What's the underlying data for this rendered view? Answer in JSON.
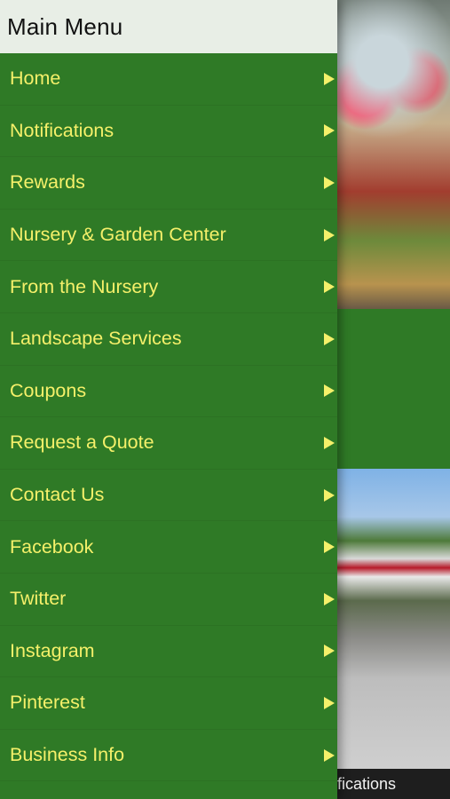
{
  "header": {
    "title": "Main Menu"
  },
  "menu": {
    "items": [
      {
        "label": "Home"
      },
      {
        "label": "Notifications"
      },
      {
        "label": "Rewards"
      },
      {
        "label": "Nursery & Garden Center"
      },
      {
        "label": "From the Nursery"
      },
      {
        "label": "Landscape Services"
      },
      {
        "label": "Coupons"
      },
      {
        "label": "Request a Quote"
      },
      {
        "label": "Contact Us"
      },
      {
        "label": "Facebook"
      },
      {
        "label": "Twitter"
      },
      {
        "label": "Instagram"
      },
      {
        "label": "Pinterest"
      },
      {
        "label": "Business Info"
      }
    ]
  },
  "background": {
    "bottom_bar_text": "fications"
  },
  "colors": {
    "drawer_bg": "#2f7a26",
    "label_color": "#f5f06a",
    "header_bg": "#e8eee6"
  },
  "icons": {
    "arrow": "triangle-right-icon"
  }
}
